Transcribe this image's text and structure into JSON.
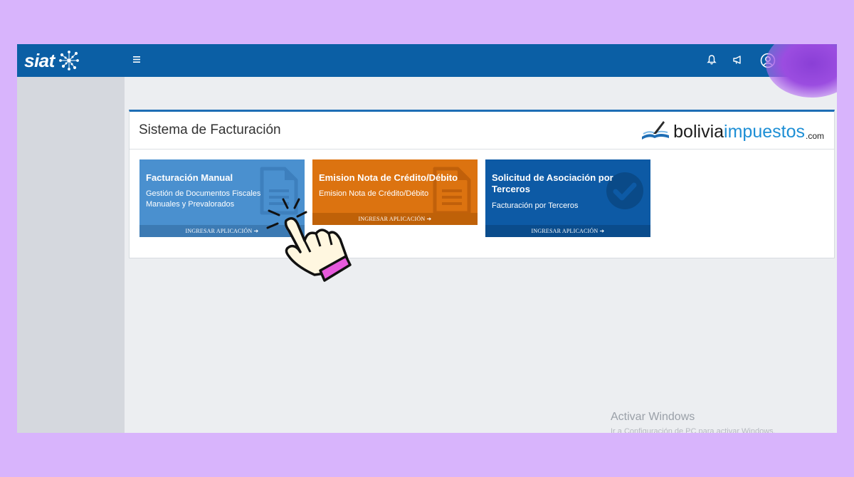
{
  "app": {
    "logo": "siat"
  },
  "topbar": {
    "menu_icon": "menu-icon",
    "icons": [
      "bell-icon",
      "megaphone-icon",
      "user-circle-icon"
    ]
  },
  "panel": {
    "title": "Sistema de Facturación",
    "brand": {
      "part1": "bolivia",
      "part2": "impuestos",
      "part3": ".com"
    }
  },
  "cards": [
    {
      "title": "Facturación Manual",
      "description": "Gestión de Documentos Fiscales Manuales y Prevalorados",
      "footer": "INGRESAR APLICACIÓN",
      "icon": "document-icon",
      "color": "#4a90cf"
    },
    {
      "title": "Emision Nota de Crédito/Débito",
      "description": "Emision Nota de Crédito/Débito",
      "footer": "INGRESAR APLICACIÓN",
      "icon": "document-icon",
      "color": "#dc7310"
    },
    {
      "title": "Solicitud de Asociación por Terceros",
      "description": "Facturación por Terceros",
      "footer": "INGRESAR APLICACIÓN",
      "icon": "check-circle-icon",
      "color": "#0d5aa5"
    }
  ],
  "watermark": {
    "title": "Activar Windows",
    "subtitle": "Ir a Configuración de PC para activar Windows."
  },
  "colors": {
    "background": "#d8b4fc",
    "header": "#0b5fa5",
    "accent": "#1e8fd5"
  }
}
